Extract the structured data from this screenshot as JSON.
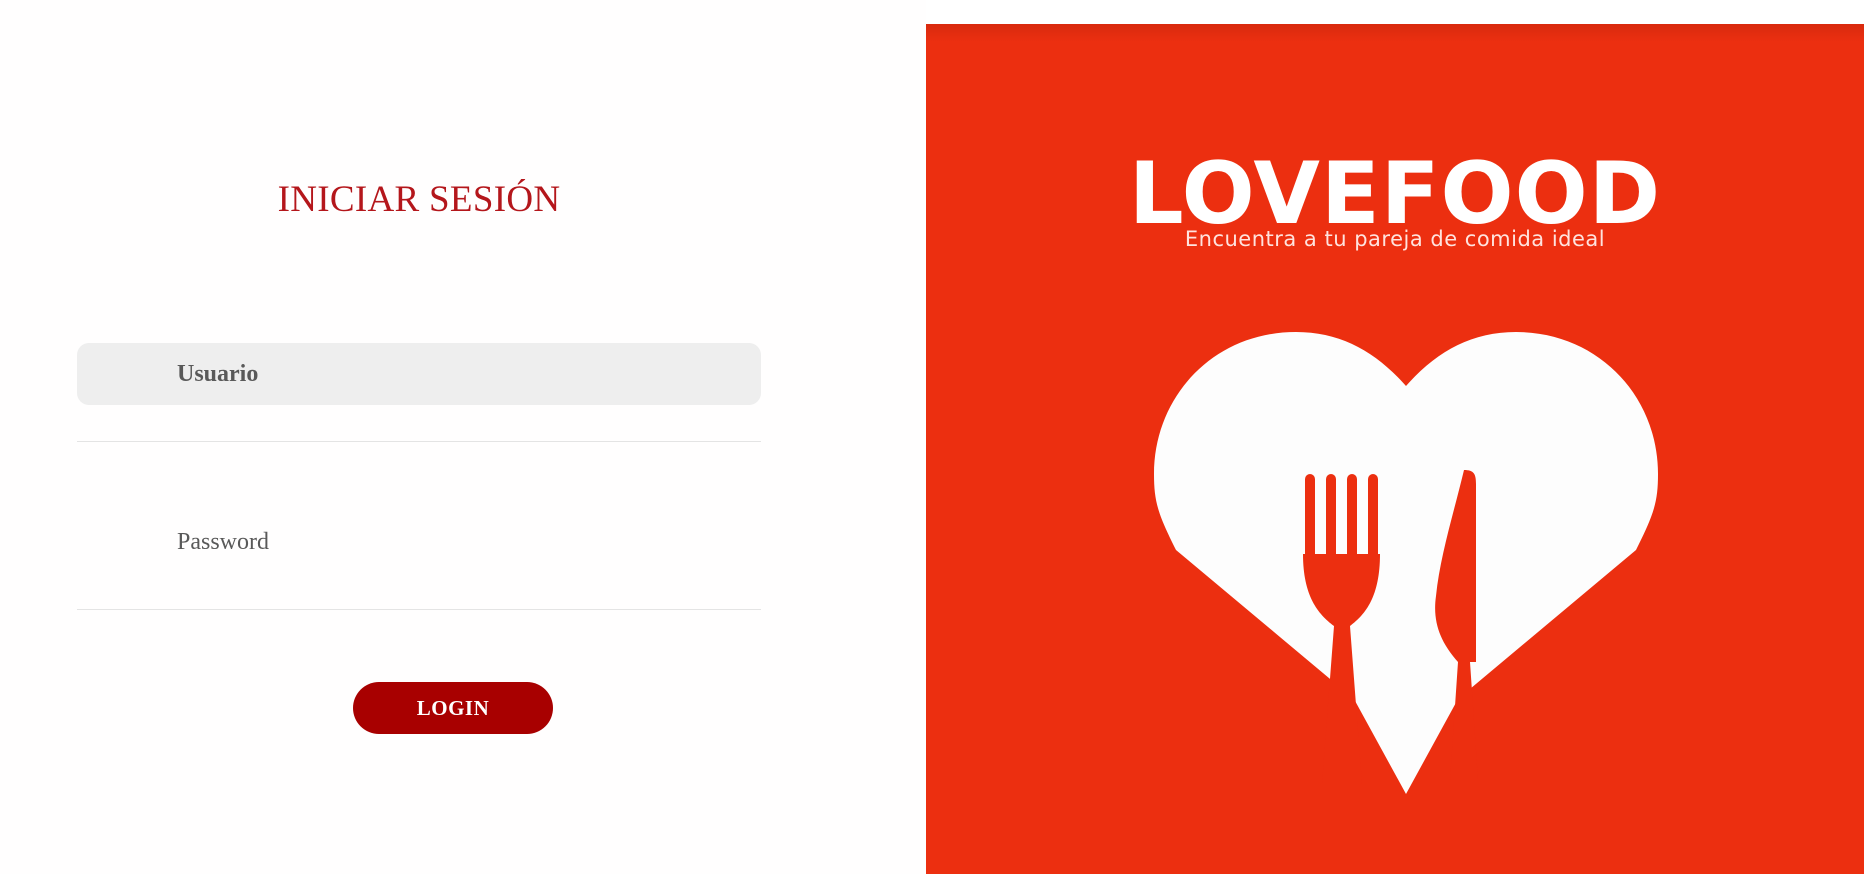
{
  "login": {
    "title": "INICIAR SESIÓN",
    "username_placeholder": "Usuario",
    "username_value": "",
    "password_placeholder": "Password",
    "password_value": "",
    "login_button_label": "LOGIN"
  },
  "brand": {
    "logo_text": "LOVEFOOD",
    "tagline": "Encuentra a tu pareja de comida ideal",
    "graphic_icon": "heart-fork-knife-icon",
    "brand_color": "#ec2f10",
    "accent_color": "#a80000"
  }
}
